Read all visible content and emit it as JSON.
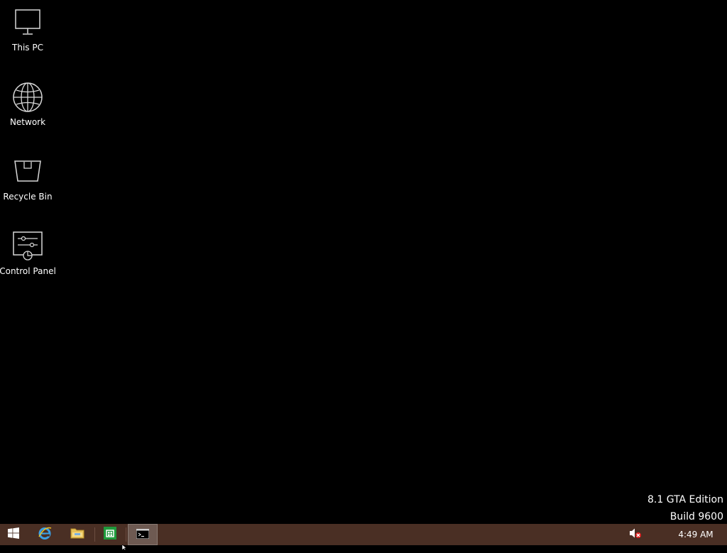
{
  "desktop": {
    "background_color": "#000000",
    "icons": [
      {
        "label": "This PC",
        "icon": "monitor-icon"
      },
      {
        "label": "Network",
        "icon": "globe-icon"
      },
      {
        "label": "Recycle Bin",
        "icon": "recycle-bin-icon"
      },
      {
        "label": "Control Panel",
        "icon": "control-panel-icon"
      }
    ],
    "watermark": {
      "line1": "8.1 GTA Edition",
      "line2": "Build 9600"
    }
  },
  "taskbar": {
    "color": "#4a2f24",
    "pinned": [
      {
        "name": "start",
        "icon": "windows-logo-icon"
      },
      {
        "name": "internet-explorer",
        "icon": "internet-explorer-icon"
      },
      {
        "name": "file-explorer",
        "icon": "folder-icon"
      },
      {
        "name": "store",
        "icon": "store-icon"
      },
      {
        "name": "command-prompt",
        "icon": "command-prompt-icon",
        "active": true
      }
    ],
    "tray": {
      "volume_icon": "volume-muted-icon",
      "clock": "4:49 AM"
    }
  }
}
